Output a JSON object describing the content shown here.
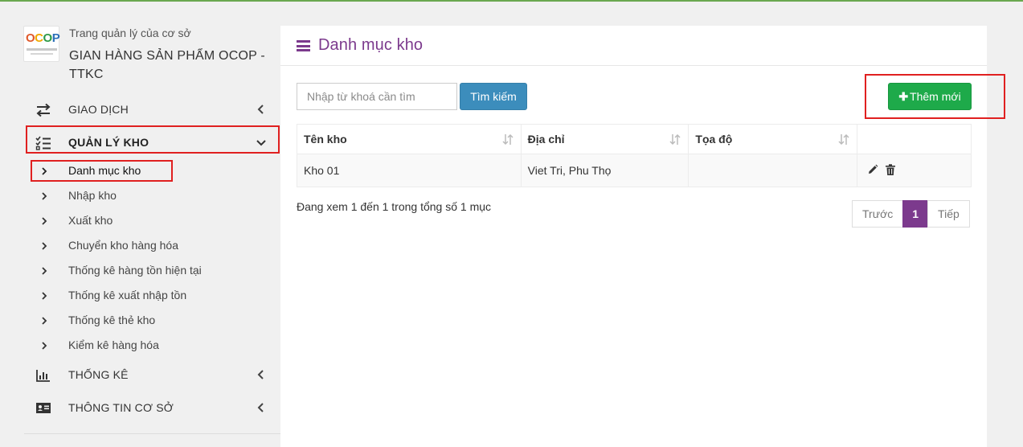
{
  "brand": {
    "logo_text": "OCOP",
    "subtitle": "Trang quản lý của cơ sở",
    "title": "GIAN HÀNG SẢN PHẨM OCOP - TTKC"
  },
  "sidebar": {
    "menu": [
      {
        "label": "GIAO DỊCH",
        "icon": "exchange-icon",
        "state": "collapsed"
      },
      {
        "label": "QUẢN LÝ KHO",
        "icon": "checklist-icon",
        "state": "expanded"
      },
      {
        "label": "THỐNG KÊ",
        "icon": "bar-chart-icon",
        "state": "collapsed"
      },
      {
        "label": "THÔNG TIN CƠ SỞ",
        "icon": "id-card-icon",
        "state": "collapsed"
      }
    ],
    "submenu": [
      {
        "label": "Danh mục kho"
      },
      {
        "label": "Nhập kho"
      },
      {
        "label": "Xuất kho"
      },
      {
        "label": "Chuyển kho hàng hóa"
      },
      {
        "label": "Thống kê hàng tồn hiện tại"
      },
      {
        "label": "Thống kê xuất nhập tồn"
      },
      {
        "label": "Thống kê thẻ kho"
      },
      {
        "label": "Kiểm kê hàng hóa"
      }
    ]
  },
  "main": {
    "title": "Danh mục kho",
    "search": {
      "placeholder": "Nhập từ khoá cần tìm",
      "value": "",
      "button": "Tìm kiếm"
    },
    "add_button": "Thêm mới",
    "table": {
      "columns": [
        "Tên kho",
        "Địa chỉ",
        "Tọa độ",
        ""
      ],
      "rows": [
        {
          "name": "Kho 01",
          "address": "Viet Tri, Phu Thọ",
          "coords": ""
        }
      ]
    },
    "info": "Đang xem 1 đến 1 trong tổng số 1 mục",
    "pagination": {
      "prev": "Trước",
      "current": "1",
      "next": "Tiếp"
    }
  },
  "colors": {
    "accent": "#7c3a8d",
    "primary_button": "#3c8dbc",
    "success_button": "#1eaa4a",
    "highlight": "#e02020"
  }
}
